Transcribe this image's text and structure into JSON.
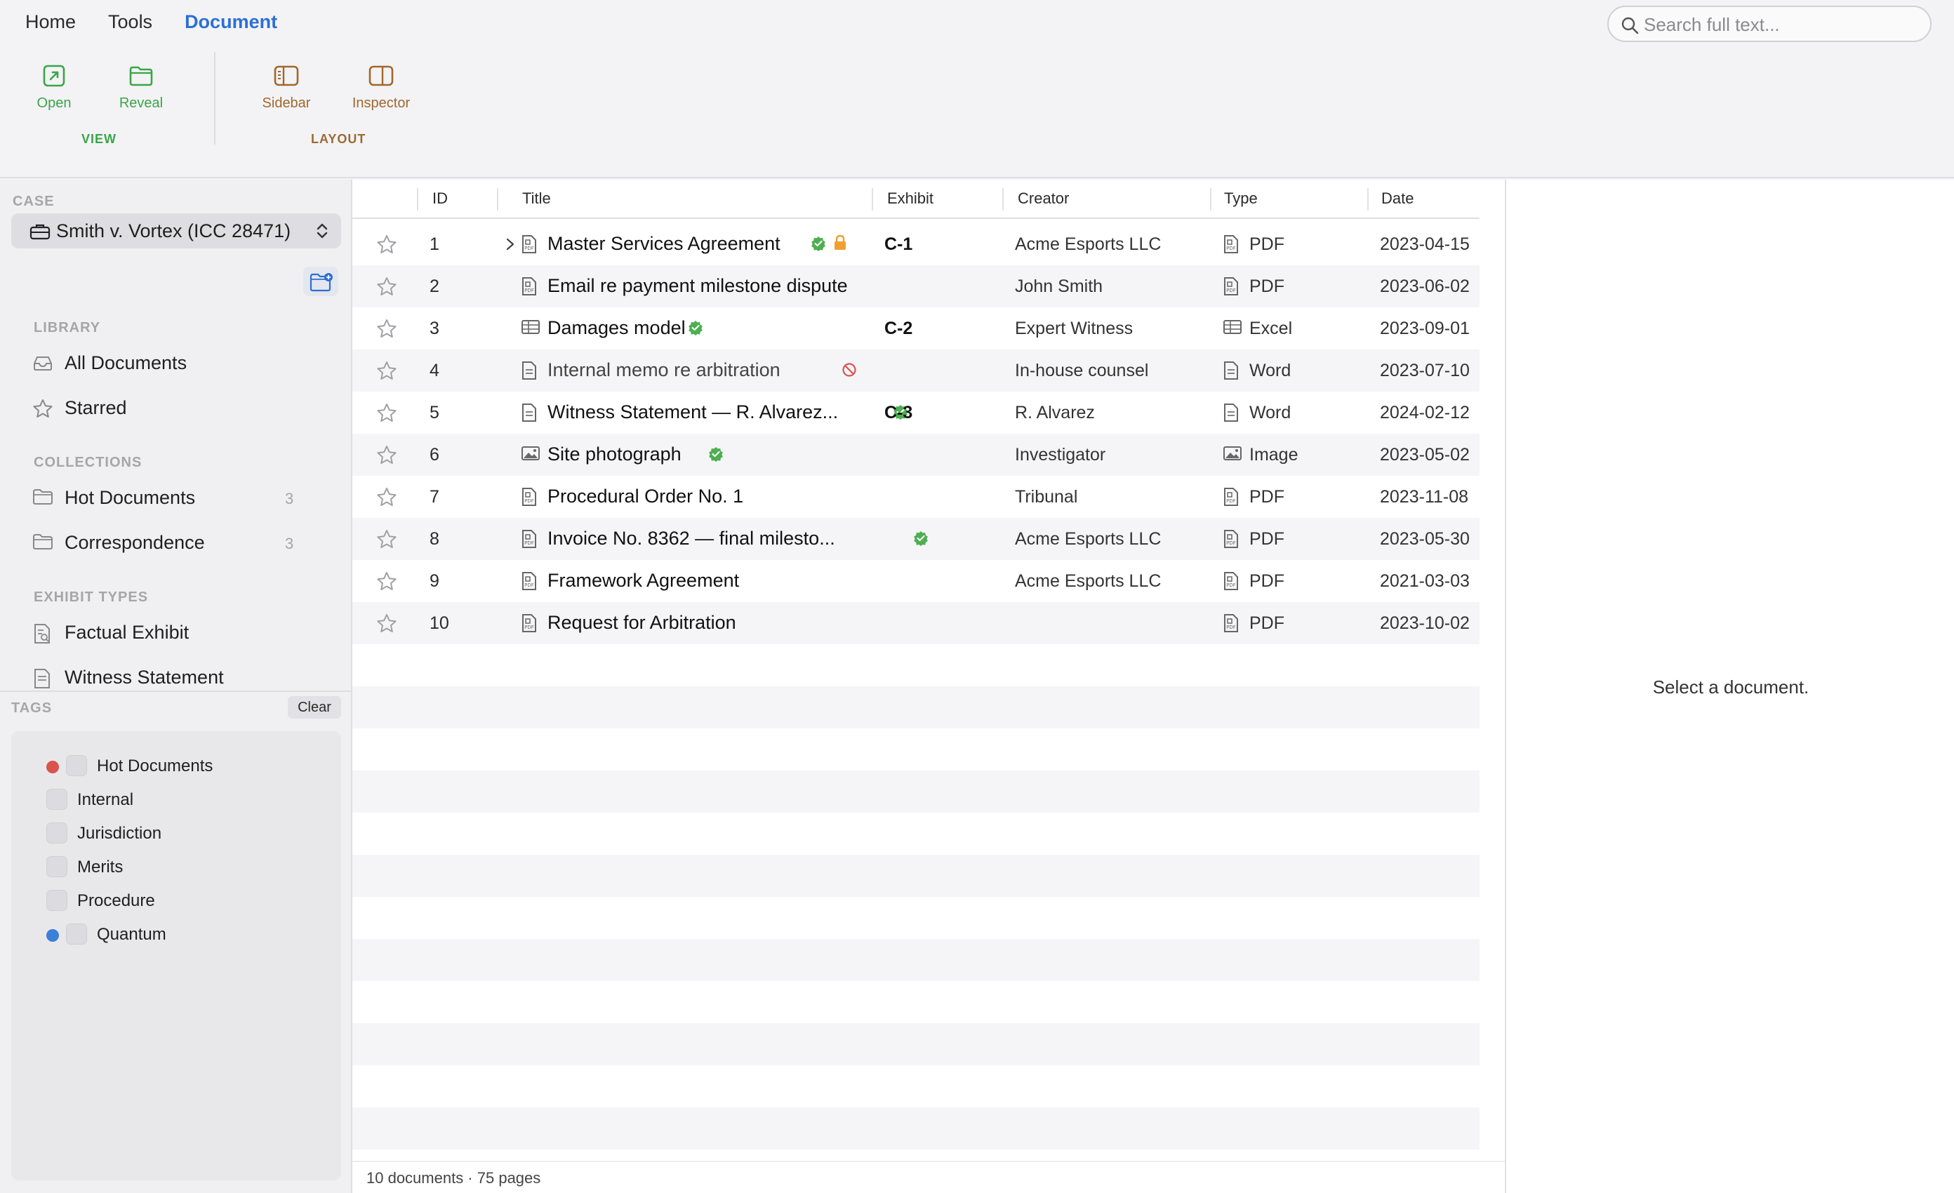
{
  "menu": {
    "tabs": [
      {
        "label": "Home"
      },
      {
        "label": "Tools"
      },
      {
        "label": "Document",
        "active": true
      }
    ]
  },
  "search": {
    "placeholder": "Search full text..."
  },
  "toolbar": {
    "view_group": {
      "label": "VIEW",
      "buttons": [
        {
          "label": "Open",
          "icon": "open-external-icon"
        },
        {
          "label": "Reveal",
          "icon": "folder-icon"
        }
      ]
    },
    "layout_group": {
      "label": "LAYOUT",
      "buttons": [
        {
          "label": "Sidebar",
          "icon": "sidebar-left-icon"
        },
        {
          "label": "Inspector",
          "icon": "sidebar-right-icon"
        }
      ]
    }
  },
  "sidebar": {
    "case_header": "CASE",
    "case_name": "Smith v. Vortex (ICC 28471)",
    "library_header": "LIBRARY",
    "library": [
      {
        "label": "All Documents",
        "icon": "tray-icon"
      },
      {
        "label": "Starred",
        "icon": "star-icon"
      }
    ],
    "collections_header": "COLLECTIONS",
    "collections": [
      {
        "label": "Hot Documents",
        "count": "3",
        "icon": "folder-icon"
      },
      {
        "label": "Correspondence",
        "count": "3",
        "icon": "folder-icon"
      }
    ],
    "exhibit_types_header": "EXHIBIT TYPES",
    "exhibit_types": [
      {
        "label": "Factual Exhibit",
        "icon": "doc-search-icon"
      },
      {
        "label": "Witness Statement",
        "icon": "doc-icon"
      }
    ]
  },
  "tags": {
    "header": "TAGS",
    "clear_label": "Clear",
    "items": [
      {
        "label": "Hot Documents",
        "color": "#d9534f"
      },
      {
        "label": "Internal",
        "color": null
      },
      {
        "label": "Jurisdiction",
        "color": null
      },
      {
        "label": "Merits",
        "color": null
      },
      {
        "label": "Procedure",
        "color": null
      },
      {
        "label": "Quantum",
        "color": "#3c7fd8"
      }
    ]
  },
  "table": {
    "columns": {
      "id": "ID",
      "title": "Title",
      "exhibit": "Exhibit",
      "creator": "Creator",
      "type": "Type",
      "date": "Date"
    },
    "rows": [
      {
        "id": "1",
        "title": "Master Services Agreement",
        "exhibit": "C-1",
        "creator": "Acme Esports LLC",
        "type": "PDF",
        "date": "2023-04-15",
        "status": "verified",
        "locked": true,
        "expandable": true
      },
      {
        "id": "2",
        "title": "Email re payment milestone dispute",
        "exhibit": "",
        "creator": "John Smith",
        "type": "PDF",
        "date": "2023-06-02",
        "status": "none"
      },
      {
        "id": "3",
        "title": "Damages model",
        "exhibit": "C-2",
        "creator": "Expert Witness",
        "type": "Excel",
        "date": "2023-09-01",
        "status": "verified"
      },
      {
        "id": "4",
        "title": "Internal memo re arbitration",
        "exhibit": "",
        "creator": "In-house counsel",
        "type": "Word",
        "date": "2023-07-10",
        "status": "privileged"
      },
      {
        "id": "5",
        "title": "Witness Statement — R. Alvarez...",
        "exhibit": "C-3",
        "creator": "R. Alvarez",
        "type": "Word",
        "date": "2024-02-12",
        "status": "verified"
      },
      {
        "id": "6",
        "title": "Site photograph",
        "exhibit": "",
        "creator": "Investigator",
        "type": "Image",
        "date": "2023-05-02",
        "status": "verified"
      },
      {
        "id": "7",
        "title": "Procedural Order No. 1",
        "exhibit": "",
        "creator": "Tribunal",
        "type": "PDF",
        "date": "2023-11-08",
        "status": "none"
      },
      {
        "id": "8",
        "title": "Invoice No. 8362 — final milesto...",
        "exhibit": "",
        "creator": "Acme Esports LLC",
        "type": "PDF",
        "date": "2023-05-30",
        "status": "verified"
      },
      {
        "id": "9",
        "title": "Framework Agreement",
        "exhibit": "",
        "creator": "Acme Esports LLC",
        "type": "PDF",
        "date": "2021-03-03",
        "status": "none"
      },
      {
        "id": "10",
        "title": "Request for Arbitration",
        "exhibit": "",
        "creator": "",
        "type": "PDF",
        "date": "2023-10-02",
        "status": "none"
      }
    ],
    "footer": "10 documents · 75 pages"
  },
  "inspector": {
    "empty_message": "Select a document."
  },
  "colors": {
    "accent": "#2d6fd6",
    "view_group": "#3aa548",
    "layout_group": "#a2672c",
    "verified": "#4caf50",
    "locked": "#f0a030",
    "privileged": "#d9534f"
  }
}
